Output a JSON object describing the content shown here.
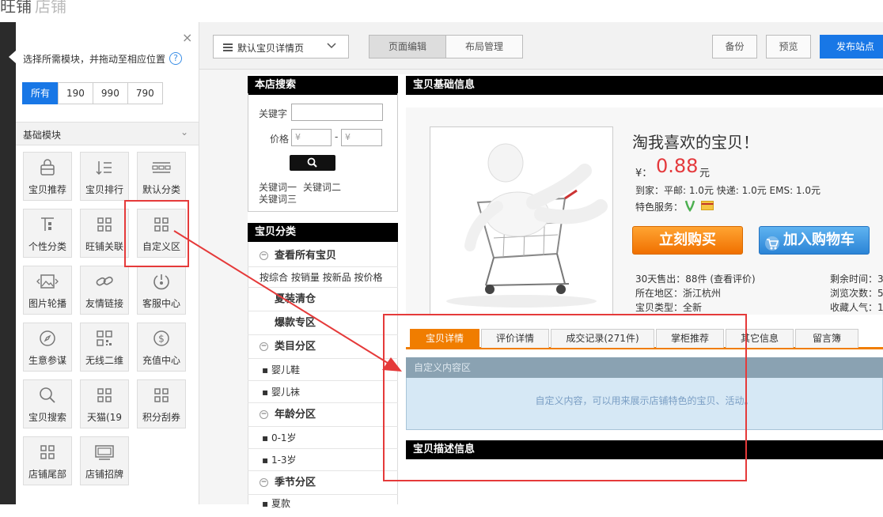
{
  "top_brand": {
    "title": "旺铺",
    "subtitle": "店铺"
  },
  "left_panel": {
    "close_label": "×",
    "hint": "选择所需模块，并拖动至相应位置",
    "help_label": "?",
    "filters": [
      "所有",
      "190",
      "990",
      "790"
    ],
    "section_title": "基础模块",
    "modules": [
      {
        "name": "宝贝推荐",
        "icon": "bag-icon"
      },
      {
        "name": "宝贝排行",
        "icon": "rank-list-icon"
      },
      {
        "name": "默认分类",
        "icon": "category-bar-icon"
      },
      {
        "name": "个性分类",
        "icon": "tree-icon"
      },
      {
        "name": "旺铺关联",
        "icon": "grid-icon"
      },
      {
        "name": "自定义区",
        "icon": "grid-icon"
      },
      {
        "name": "图片轮播",
        "icon": "image-carousel-icon"
      },
      {
        "name": "友情链接",
        "icon": "link-icon"
      },
      {
        "name": "客服中心",
        "icon": "service-icon"
      },
      {
        "name": "生意参谋",
        "icon": "compass-icon"
      },
      {
        "name": "无线二维",
        "icon": "qrcode-icon"
      },
      {
        "name": "充值中心",
        "icon": "dollar-icon"
      },
      {
        "name": "宝贝搜索",
        "icon": "search-icon"
      },
      {
        "name": "天猫(19",
        "icon": "grid-icon"
      },
      {
        "name": "积分刮券",
        "icon": "grid-icon"
      },
      {
        "name": "店铺尾部",
        "icon": "grid-icon"
      },
      {
        "name": "店铺招牌",
        "icon": "signboard-icon"
      }
    ]
  },
  "toolbar": {
    "page_select": "默认宝贝详情页",
    "tabs": [
      "页面编辑",
      "布局管理"
    ],
    "backup": "备份",
    "preview": "预览",
    "publish": "发布站点"
  },
  "search_module": {
    "title": "本店搜索",
    "keyword_label": "关键字",
    "price_label": "价格",
    "price_min_placeholder": "¥",
    "price_max_placeholder": "¥",
    "dash": "-",
    "keywords": [
      "关键词一",
      "关键词二",
      "关键词三"
    ]
  },
  "category_module": {
    "title": "宝贝分类",
    "view_all": "查看所有宝贝",
    "sort_links": [
      "按综合",
      "按销量",
      "按新品",
      "按价格"
    ],
    "rows": [
      {
        "type": "bold",
        "label": "夏装清仓"
      },
      {
        "type": "bold",
        "label": "爆款专区"
      },
      {
        "type": "group",
        "label": "类目分区"
      },
      {
        "type": "item",
        "label": "婴儿鞋"
      },
      {
        "type": "item",
        "label": "婴儿袜"
      },
      {
        "type": "group",
        "label": "年龄分区"
      },
      {
        "type": "item",
        "label": "0-1岁"
      },
      {
        "type": "item",
        "label": "1-3岁"
      },
      {
        "type": "group",
        "label": "季节分区"
      },
      {
        "type": "item",
        "label": "夏款"
      }
    ]
  },
  "product": {
    "section_title": "宝贝基础信息",
    "title": "淘我喜欢的宝贝！",
    "currency": "¥：",
    "price": "0.88",
    "unit": "元",
    "shipping": "到家：平邮: 1.0元   快递: 1.0元   EMS: 1.0元",
    "services_label": "特色服务：",
    "buy_button": "立刻购买",
    "cart_button": "加入购物车",
    "stats_left": [
      "30天售出：88件 (查看评价)",
      "所在地区：浙江杭州",
      "宝贝类型：全新"
    ],
    "stats_right": [
      "剩余时间：3",
      "浏览次数：5",
      "收藏人气：1"
    ]
  },
  "detail_tabs": [
    "宝贝详情",
    "评价详情",
    "成交记录(271件)",
    "掌柜推荐",
    "其它信息",
    "留言簿"
  ],
  "custom_area": {
    "title": "自定义内容区",
    "text": "自定义内容，可以用来展示店铺特色的宝贝、活动。"
  },
  "description_section": {
    "title": "宝贝描述信息"
  },
  "colors": {
    "accent_blue": "#1877e6",
    "orange": "#f07d00",
    "price_red": "#e4393c",
    "highlight_red": "#e53a3a"
  }
}
